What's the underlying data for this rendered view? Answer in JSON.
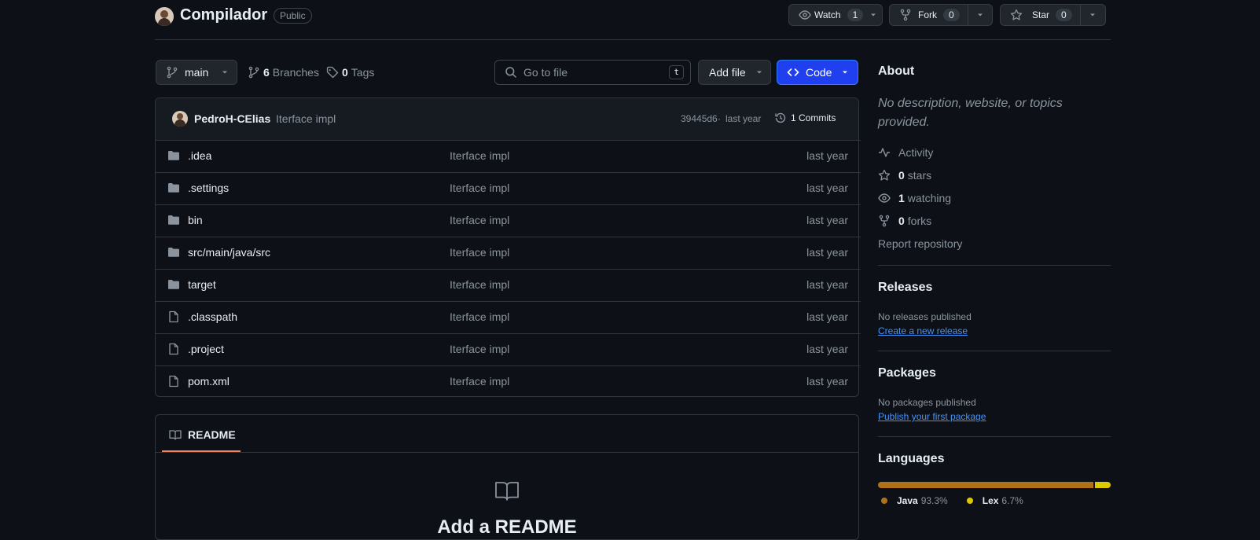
{
  "repo": {
    "name": "Compilador",
    "visibility": "Public"
  },
  "actions": {
    "watch": {
      "label": "Watch",
      "count": "1"
    },
    "fork": {
      "label": "Fork",
      "count": "0"
    },
    "star": {
      "label": "Star",
      "count": "0"
    }
  },
  "toolbar": {
    "branch": "main",
    "branches_count": "6",
    "branches_label": "Branches",
    "tags_count": "0",
    "tags_label": "Tags",
    "search_placeholder": "Go to file",
    "search_shortcut": "t",
    "add_file": "Add file",
    "code": "Code"
  },
  "commit": {
    "author": "PedroH-CElias",
    "message": "Iterface impl",
    "hash": "39445d6",
    "time": "last year",
    "commits_label": "1 Commits"
  },
  "files": [
    {
      "type": "folder",
      "name": ".idea",
      "message": "Iterface impl",
      "time": "last year"
    },
    {
      "type": "folder",
      "name": ".settings",
      "message": "Iterface impl",
      "time": "last year"
    },
    {
      "type": "folder",
      "name": "bin",
      "message": "Iterface impl",
      "time": "last year"
    },
    {
      "type": "folder",
      "name": "src/main/java/src",
      "message": "Iterface impl",
      "time": "last year"
    },
    {
      "type": "folder",
      "name": "target",
      "message": "Iterface impl",
      "time": "last year"
    },
    {
      "type": "file",
      "name": ".classpath",
      "message": "Iterface impl",
      "time": "last year"
    },
    {
      "type": "file",
      "name": ".project",
      "message": "Iterface impl",
      "time": "last year"
    },
    {
      "type": "file",
      "name": "pom.xml",
      "message": "Iterface impl",
      "time": "last year"
    }
  ],
  "readme": {
    "tab": "README",
    "title": "Add a README"
  },
  "sidebar": {
    "about_title": "About",
    "about_desc": "No description, website, or topics provided.",
    "activity": "Activity",
    "stars_count": "0",
    "stars_label": "stars",
    "watching_count": "1",
    "watching_label": "watching",
    "forks_count": "0",
    "forks_label": "forks",
    "report": "Report repository",
    "releases_title": "Releases",
    "releases_none": "No releases published",
    "releases_link": "Create a new release",
    "packages_title": "Packages",
    "packages_none": "No packages published",
    "packages_link": "Publish your first package",
    "languages_title": "Languages",
    "languages": [
      {
        "name": "Java",
        "percent": "93.3%",
        "value": 93.3,
        "color": "#b07219"
      },
      {
        "name": "Lex",
        "percent": "6.7%",
        "value": 6.7,
        "color": "#dbca00"
      }
    ]
  }
}
